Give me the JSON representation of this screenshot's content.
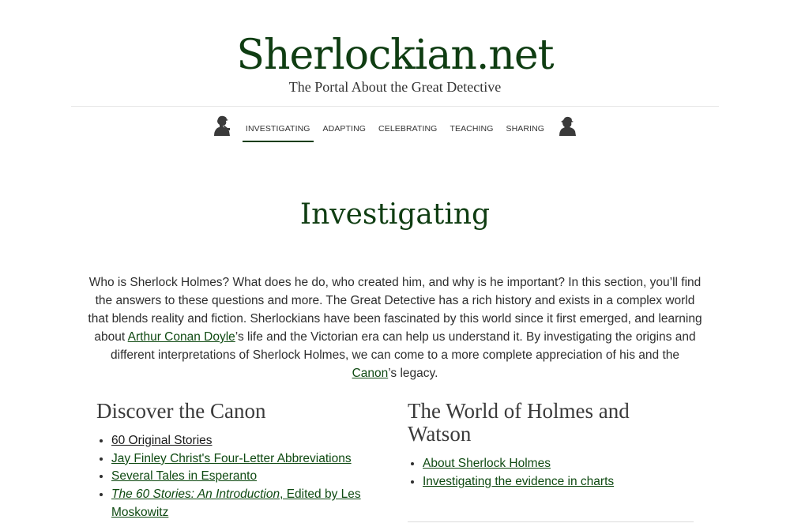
{
  "site": {
    "title": "Sherlockian.net",
    "tagline": "The Portal About the Great Detective"
  },
  "nav": {
    "left_icon": "holmes-pipe-silhouette-icon",
    "right_icon": "deerstalker-silhouette-icon",
    "items": [
      {
        "label": "INVESTIGATING",
        "active": true
      },
      {
        "label": "ADAPTING",
        "active": false
      },
      {
        "label": "CELEBRATING",
        "active": false
      },
      {
        "label": "TEACHING",
        "active": false
      },
      {
        "label": "SHARING",
        "active": false
      }
    ]
  },
  "page": {
    "heading": "Investigating",
    "intro": {
      "p1": "Who is Sherlock Holmes? What does he do, who created him, and why is he important? In this section, you’ll find the answers to these questions and more. The Great Detective has a rich history and exists in a complex world that blends reality and fiction. Sherlockians have been fascinated by this world since it first emerged, and learning about ",
      "link1": "Arthur Conan Doyle",
      "p2": "’s life and the Victorian era can help us understand it. By investigating the origins and different interpretations of Sherlock Holmes, we can come to a more complete appreciation of his and the ",
      "link2": "Canon",
      "p3": "’s legacy."
    }
  },
  "sections": {
    "discover": {
      "heading": "Discover the Canon",
      "items": [
        "60 Original Stories",
        "Jay Finley Christ's Four-Letter Abbreviations",
        "Several Tales in Esperanto"
      ],
      "book_title": "The 60 Stories: An Introduction",
      "book_suffix": ", Edited by Les Moskowitz"
    },
    "world": {
      "heading": "The World of Holmes and Watson",
      "items": [
        "About Sherlock Holmes",
        "Investigating the evidence in charts"
      ]
    }
  },
  "colors": {
    "brand_green": "#0f3d12",
    "link_green": "#0f4a12",
    "text": "#2e2e2e"
  }
}
